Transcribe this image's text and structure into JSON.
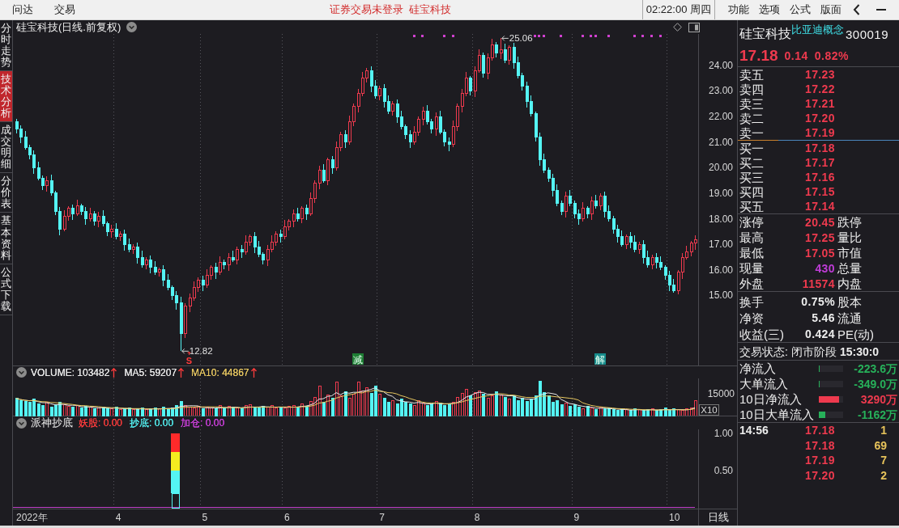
{
  "top_bar": {
    "menu_left": [
      "问达",
      "交易"
    ],
    "notices": [
      "证券交易未登录",
      "硅宝科技"
    ],
    "clock": "02:22:00 周四",
    "menu_right": [
      "功能",
      "选项",
      "公式",
      "版面"
    ]
  },
  "side_tabs": [
    {
      "label": "分时走势",
      "selected": false
    },
    {
      "label": "技术分析",
      "selected": true
    },
    {
      "label": "成交明细",
      "selected": false
    },
    {
      "label": "分价表",
      "selected": false
    },
    {
      "label": "基本资料",
      "selected": false
    },
    {
      "label": "公式下载",
      "selected": false
    }
  ],
  "price_panel": {
    "title": "硅宝科技(日线.前复权)",
    "y_labels": [
      "24.00",
      "23.00",
      "22.00",
      "21.00",
      "20.00",
      "19.00",
      "18.00",
      "17.00",
      "16.00",
      "15.00"
    ],
    "high_label": "25.06",
    "low_label": "12.82",
    "signals": [
      {
        "kind": "signal",
        "label": "S",
        "color": "#ff3c3c"
      },
      {
        "kind": "tag",
        "label": "减",
        "color": "#1e7e34"
      },
      {
        "kind": "tag",
        "label": "解",
        "color": "#178c8c"
      }
    ]
  },
  "volume_panel": {
    "legend": [
      {
        "label": "VOLUME: 103482",
        "color": "#e8e8e8",
        "rising": true
      },
      {
        "label": "MA5: 59207",
        "color": "#e8e8e8",
        "rising": true
      },
      {
        "label": "MA10: 44867",
        "color": "#e8c860",
        "rising": true
      }
    ],
    "axis_label": "15000",
    "scale_label": "X10"
  },
  "indicator_panel": {
    "title": "派神抄底",
    "legend": [
      {
        "label": "妖股: 0.00",
        "color": "#ff3c3c"
      },
      {
        "label": "抄底: 0.00",
        "color": "#54f4f4"
      },
      {
        "label": "加仓: 0.00",
        "color": "#d040e0"
      }
    ],
    "chart_data": {
      "type": "bar",
      "stacked": true,
      "categories": [
        null,
        null,
        null,
        null,
        null,
        null,
        null,
        null,
        null,
        null,
        null,
        null,
        null,
        null,
        null,
        null,
        null,
        null,
        null,
        null,
        null,
        null,
        null,
        null,
        null,
        null,
        null,
        null,
        null,
        null,
        null,
        null,
        null,
        null,
        null,
        null,
        null,
        null,
        null,
        null,
        null,
        null,
        null,
        null,
        null,
        null,
        null,
        null,
        null,
        null,
        null,
        null,
        null,
        null,
        null,
        null,
        null,
        null,
        null,
        null,
        null,
        null,
        null,
        null,
        null,
        null,
        null,
        null,
        null,
        null,
        null,
        null,
        null,
        null,
        null,
        null,
        null,
        null,
        null,
        null,
        null,
        null,
        null,
        null,
        null,
        null,
        null,
        null,
        null,
        null,
        null,
        null,
        null,
        null,
        null,
        null,
        null,
        null,
        null,
        null,
        null,
        null,
        null,
        null,
        null,
        null,
        null,
        null,
        null,
        null,
        null,
        null,
        null,
        null,
        null,
        null,
        null,
        null,
        null,
        null,
        null,
        null,
        null,
        null,
        null,
        null,
        null,
        null,
        null,
        null,
        null,
        null,
        null,
        null,
        null,
        null,
        null,
        null,
        null,
        null,
        null,
        null,
        null,
        null,
        null,
        null,
        null,
        null,
        null,
        null,
        null,
        null,
        null,
        null,
        null,
        null,
        null,
        null
      ],
      "ylim": [
        0,
        1.05
      ],
      "yticks": [
        {
          "value": 0.5,
          "label": "0.50"
        },
        {
          "value": 1,
          "label": "1.00"
        }
      ],
      "series": [
        {
          "color": "#54f4f4",
          "values": [
            0,
            0,
            0,
            0,
            0,
            0,
            0,
            0,
            0,
            0,
            0,
            0,
            0,
            0,
            0,
            0,
            0,
            0,
            0,
            0,
            0,
            0,
            0,
            0,
            0,
            0,
            0,
            0,
            0,
            0,
            0,
            0,
            0,
            0,
            0,
            0,
            0,
            0.2,
            0,
            0,
            0,
            0,
            0,
            0,
            0,
            0,
            0,
            0,
            0,
            0,
            0,
            0,
            0,
            0,
            0,
            0,
            0,
            0,
            0,
            0,
            0,
            0,
            0,
            0,
            0,
            0,
            0,
            0,
            0,
            0,
            0,
            0,
            0,
            0,
            0,
            0,
            0,
            0,
            0,
            0,
            0,
            0,
            0,
            0,
            0,
            0,
            0,
            0,
            0,
            0,
            0,
            0,
            0,
            0,
            0,
            0,
            0,
            0,
            0,
            0,
            0,
            0,
            0,
            0,
            0,
            0,
            0,
            0,
            0,
            0,
            0,
            0,
            0,
            0,
            0,
            0,
            0,
            0,
            0,
            0,
            0,
            0,
            0,
            0,
            0,
            0,
            0,
            0,
            0,
            0,
            0,
            0,
            0,
            0,
            0,
            0,
            0,
            0,
            0,
            0,
            0,
            0,
            0,
            0,
            0,
            0,
            0,
            0,
            0,
            0,
            0,
            0,
            0,
            0,
            0,
            0,
            0,
            0
          ]
        },
        {
          "color": "#54f4f4",
          "values": [
            0,
            0,
            0,
            0,
            0,
            0,
            0,
            0,
            0,
            0,
            0,
            0,
            0,
            0,
            0,
            0,
            0,
            0,
            0,
            0,
            0,
            0,
            0,
            0,
            0,
            0,
            0,
            0,
            0,
            0,
            0,
            0,
            0,
            0,
            0,
            0,
            0,
            0.3,
            0,
            0,
            0,
            0,
            0,
            0,
            0,
            0,
            0,
            0,
            0,
            0,
            0,
            0,
            0,
            0,
            0,
            0,
            0,
            0,
            0,
            0,
            0,
            0,
            0,
            0,
            0,
            0,
            0,
            0,
            0,
            0,
            0,
            0,
            0,
            0,
            0,
            0,
            0,
            0,
            0,
            0,
            0,
            0,
            0,
            0,
            0,
            0,
            0,
            0,
            0,
            0,
            0,
            0,
            0,
            0,
            0,
            0,
            0,
            0,
            0,
            0,
            0,
            0,
            0,
            0,
            0,
            0,
            0,
            0,
            0,
            0,
            0,
            0,
            0,
            0,
            0,
            0,
            0,
            0,
            0,
            0,
            0,
            0,
            0,
            0,
            0,
            0,
            0,
            0,
            0,
            0,
            0,
            0,
            0,
            0,
            0,
            0,
            0,
            0,
            0,
            0,
            0,
            0,
            0,
            0,
            0,
            0,
            0,
            0,
            0,
            0,
            0,
            0,
            0,
            0,
            0,
            0,
            0,
            0
          ]
        },
        {
          "color": "#f4ec20",
          "values": [
            0,
            0,
            0,
            0,
            0,
            0,
            0,
            0,
            0,
            0,
            0,
            0,
            0,
            0,
            0,
            0,
            0,
            0,
            0,
            0,
            0,
            0,
            0,
            0,
            0,
            0,
            0,
            0,
            0,
            0,
            0,
            0,
            0,
            0,
            0,
            0,
            0,
            0.25,
            0,
            0,
            0,
            0,
            0,
            0,
            0,
            0,
            0,
            0,
            0,
            0,
            0,
            0,
            0,
            0,
            0,
            0,
            0,
            0,
            0,
            0,
            0,
            0,
            0,
            0,
            0,
            0,
            0,
            0,
            0,
            0,
            0,
            0,
            0,
            0,
            0,
            0,
            0,
            0,
            0,
            0,
            0,
            0,
            0,
            0,
            0,
            0,
            0,
            0,
            0,
            0,
            0,
            0,
            0,
            0,
            0,
            0,
            0,
            0,
            0,
            0,
            0,
            0,
            0,
            0,
            0,
            0,
            0,
            0,
            0,
            0,
            0,
            0,
            0,
            0,
            0,
            0,
            0,
            0,
            0,
            0,
            0,
            0,
            0,
            0,
            0,
            0,
            0,
            0,
            0,
            0,
            0,
            0,
            0,
            0,
            0,
            0,
            0,
            0,
            0,
            0,
            0,
            0,
            0,
            0,
            0,
            0,
            0,
            0,
            0,
            0,
            0,
            0,
            0,
            0,
            0,
            0,
            0,
            0
          ]
        },
        {
          "color": "#ff2a2a",
          "values": [
            0,
            0,
            0,
            0,
            0,
            0,
            0,
            0,
            0,
            0,
            0,
            0,
            0,
            0,
            0,
            0,
            0,
            0,
            0,
            0,
            0,
            0,
            0,
            0,
            0,
            0,
            0,
            0,
            0,
            0,
            0,
            0,
            0,
            0,
            0,
            0,
            0,
            0.25,
            0,
            0,
            0,
            0,
            0,
            0,
            0,
            0,
            0,
            0,
            0,
            0,
            0,
            0,
            0,
            0,
            0,
            0,
            0,
            0,
            0,
            0,
            0,
            0,
            0,
            0,
            0,
            0,
            0,
            0,
            0,
            0,
            0,
            0,
            0,
            0,
            0,
            0,
            0,
            0,
            0,
            0,
            0,
            0,
            0,
            0,
            0,
            0,
            0,
            0,
            0,
            0,
            0,
            0,
            0,
            0,
            0,
            0,
            0,
            0,
            0,
            0,
            0,
            0,
            0,
            0,
            0,
            0,
            0,
            0,
            0,
            0,
            0,
            0,
            0,
            0,
            0,
            0,
            0,
            0,
            0,
            0,
            0,
            0,
            0,
            0,
            0,
            0,
            0,
            0,
            0,
            0,
            0,
            0,
            0,
            0,
            0,
            0,
            0,
            0,
            0,
            0,
            0,
            0,
            0,
            0,
            0,
            0,
            0,
            0,
            0,
            0,
            0,
            0,
            0,
            0,
            0,
            0,
            0,
            0
          ]
        }
      ]
    }
  },
  "x_axis": {
    "labels": [
      "2022年",
      "4",
      "5",
      "6",
      "7",
      "8",
      "9",
      "10"
    ],
    "period": "日线"
  },
  "quote": {
    "name": "硅宝科技",
    "concept": "比亚迪概念",
    "code": "300019",
    "price": "17.18",
    "change": "0.14",
    "change_pct": "0.82%",
    "asks": [
      {
        "label": "卖五",
        "price": "17.23"
      },
      {
        "label": "卖四",
        "price": "17.22"
      },
      {
        "label": "卖三",
        "price": "17.21"
      },
      {
        "label": "卖二",
        "price": "17.20"
      },
      {
        "label": "卖一",
        "price": "17.19"
      }
    ],
    "bids": [
      {
        "label": "买一",
        "price": "17.18"
      },
      {
        "label": "买二",
        "price": "17.17"
      },
      {
        "label": "买三",
        "price": "17.16"
      },
      {
        "label": "买四",
        "price": "17.15"
      },
      {
        "label": "买五",
        "price": "17.14"
      }
    ],
    "stats": [
      {
        "label": "涨停",
        "value": "20.45",
        "color": "#ee3a4e",
        "label_2": "跌停"
      },
      {
        "label": "最高",
        "value": "17.25",
        "color": "#ee3a4e",
        "label_2": "量比"
      },
      {
        "label": "最低",
        "value": "17.05",
        "color": "#ee3a4e",
        "label_2": "市值"
      },
      {
        "label": "现量",
        "value": "430",
        "color": "#c03cd8",
        "label_2": "总量"
      },
      {
        "label": "外盘",
        "value": "11574",
        "color": "#ee3a4e",
        "label_2": "内盘"
      }
    ],
    "ratios": [
      {
        "label": "换手",
        "value": "0.75%",
        "label_2": "股本"
      },
      {
        "label": "净资",
        "value": "5.46",
        "label_2": "流通"
      },
      {
        "label": "收益(三)",
        "value": "0.424",
        "label_2": "PE(动)"
      }
    ],
    "trade_status": {
      "label": "交易状态:",
      "value": "闭市阶段",
      "time": "15:30:0"
    },
    "money_flow": [
      {
        "label": "净流入",
        "level": 0.04,
        "color": "#27b05a",
        "value": "-223.6万"
      },
      {
        "label": "大单流入",
        "level": 0.04,
        "color": "#27b05a",
        "value": "-349.0万"
      },
      {
        "label": "10日净流入",
        "level": 0.82,
        "color": "#ee3a4e",
        "value": "3290万"
      },
      {
        "label": "10日大单流入",
        "level": 0.27,
        "color": "#27b05a",
        "value": "-1162万"
      }
    ],
    "ticks": [
      {
        "time": "14:56",
        "price": "17.18",
        "volume": "1"
      },
      {
        "price": "17.18",
        "volume": "69"
      },
      {
        "price": "17.19",
        "volume": "7"
      },
      {
        "price": "17.20",
        "volume": "2"
      }
    ]
  }
}
